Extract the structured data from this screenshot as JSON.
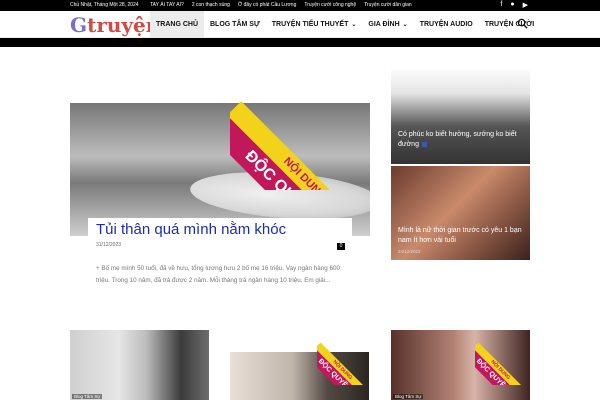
{
  "topbar": {
    "date": "Chủ Nhật, Tháng Một 28, 2024",
    "links": [
      "TAY ÁI TAY AI?",
      "2 con thạch sùng",
      "Ở đây có phát Cầu Lương",
      "Truyện cười công nghệ",
      "Truyện cười dân gian"
    ],
    "social": [
      "facebook-icon",
      "github-icon",
      "youtube-icon"
    ]
  },
  "logo": {
    "first": "G",
    "rest": "truyện"
  },
  "menu": [
    {
      "label": "TRANG CHỦ",
      "active": true,
      "dropdown": false
    },
    {
      "label": "BLOG TÂM SỰ",
      "active": false,
      "dropdown": false
    },
    {
      "label": "TRUYỆN TIỂU THUYẾT",
      "active": false,
      "dropdown": true
    },
    {
      "label": "GIA ĐÌNH",
      "active": false,
      "dropdown": true
    },
    {
      "label": "TRUYỆN AUDIO",
      "active": false,
      "dropdown": false
    },
    {
      "label": "TRUYỆN CƯỜI",
      "active": false,
      "dropdown": false
    }
  ],
  "badge": {
    "top": "NỘI DUNG",
    "bottom": "ĐỘC QUYỀN",
    "small_top": "NỘI DUNG",
    "small_bottom": "ĐỘC QUYỀN"
  },
  "hero": {
    "title": "Tủi thân quá mình nằm khóc",
    "date": "31/12/2023",
    "comments": "0",
    "excerpt": "+ Bố mẹ mình 50 tuổi, đã về hưu, tổng lương hưu 2 bố mẹ 16 triệu. Vay ngân hàng 600 triệu. Trong 10 năm, đã trả được 2 năm. Mỗi tháng trả ngân hàng 10 triệu. Em giải..."
  },
  "side_posts": [
    {
      "title": "Có phúc ko biết hưởng, sướng ko biết đường",
      "date": ""
    },
    {
      "title": "Mình là nữ thời gian trước có yêu 1 bạn nam ít hơn vài tuổi",
      "date": "24/12/2023"
    }
  ],
  "bottom_cards": [
    {
      "category": "Blog Tâm Sự"
    },
    {
      "category": ""
    },
    {
      "category": "Blog Tâm Sự"
    }
  ],
  "colors": {
    "accent_pink": "#c3175c",
    "accent_yellow": "#f3d21a",
    "title_blue": "#1b2fa6"
  }
}
